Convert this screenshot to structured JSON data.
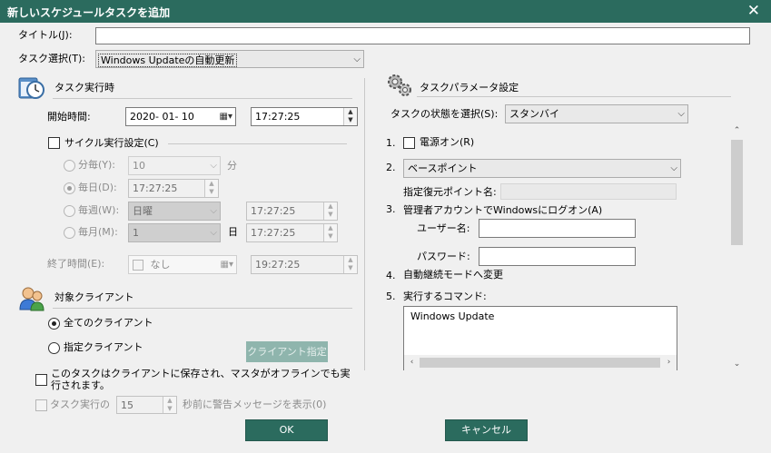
{
  "window": {
    "title": "新しいスケジュールタスクを追加",
    "close": "✕"
  },
  "title_field": {
    "label": "タイトル(J):",
    "value": ""
  },
  "task_select": {
    "label": "タスク選択(T):",
    "value": "Windows Updateの自動更新"
  },
  "exec_time": {
    "header": "タスク実行時",
    "start_label": "開始時間:",
    "start_date": "2020- 01- 10",
    "start_time": "17:27:25",
    "cycle_label": "サイクル実行設定(C)",
    "per_minute": {
      "label": "分毎(Y):",
      "value": "10",
      "unit": "分"
    },
    "daily": {
      "label": "毎日(D):",
      "time": "17:27:25"
    },
    "weekly": {
      "label": "毎週(W):",
      "day": "日曜",
      "time": "17:27:25"
    },
    "monthly": {
      "label": "毎月(M):",
      "day": "1",
      "unit": "日",
      "time": "17:27:25"
    },
    "end_label": "終了時間(E):",
    "end_date": "なし",
    "end_time": "19:27:25"
  },
  "clients": {
    "header": "対象クライアント",
    "all": "全てのクライアント",
    "specific": "指定クライアント",
    "specify_button": "クライアント指定"
  },
  "offline_save": "このタスクはクライアントに保存され、マスタがオフラインでも実行されます。",
  "warning": {
    "prefix": "タスク実行の",
    "value": "15",
    "suffix": "秒前に警告メッセージを表示(0)"
  },
  "params": {
    "header": "タスクパラメータ設定",
    "state_label": "タスクの状態を選択(S):",
    "state_value": "スタンバイ",
    "items": {
      "n1": "1.",
      "power_on": "電源オン(R)",
      "n2": "2.",
      "base_point": "ベースポイント",
      "restore_label": "指定復元ポイント名:",
      "n3": "3.",
      "admin_logon": "管理者アカウントでWindowsにログオン(A)",
      "user_label": "ユーザー名:",
      "password_label": "パスワード:",
      "n4": "4.",
      "auto_continue": "自動継続モードへ変更",
      "n5": "5.",
      "command_label": "実行するコマンド:",
      "command_value": "Windows Update"
    }
  },
  "buttons": {
    "ok": "OK",
    "cancel": "キャンセル"
  }
}
